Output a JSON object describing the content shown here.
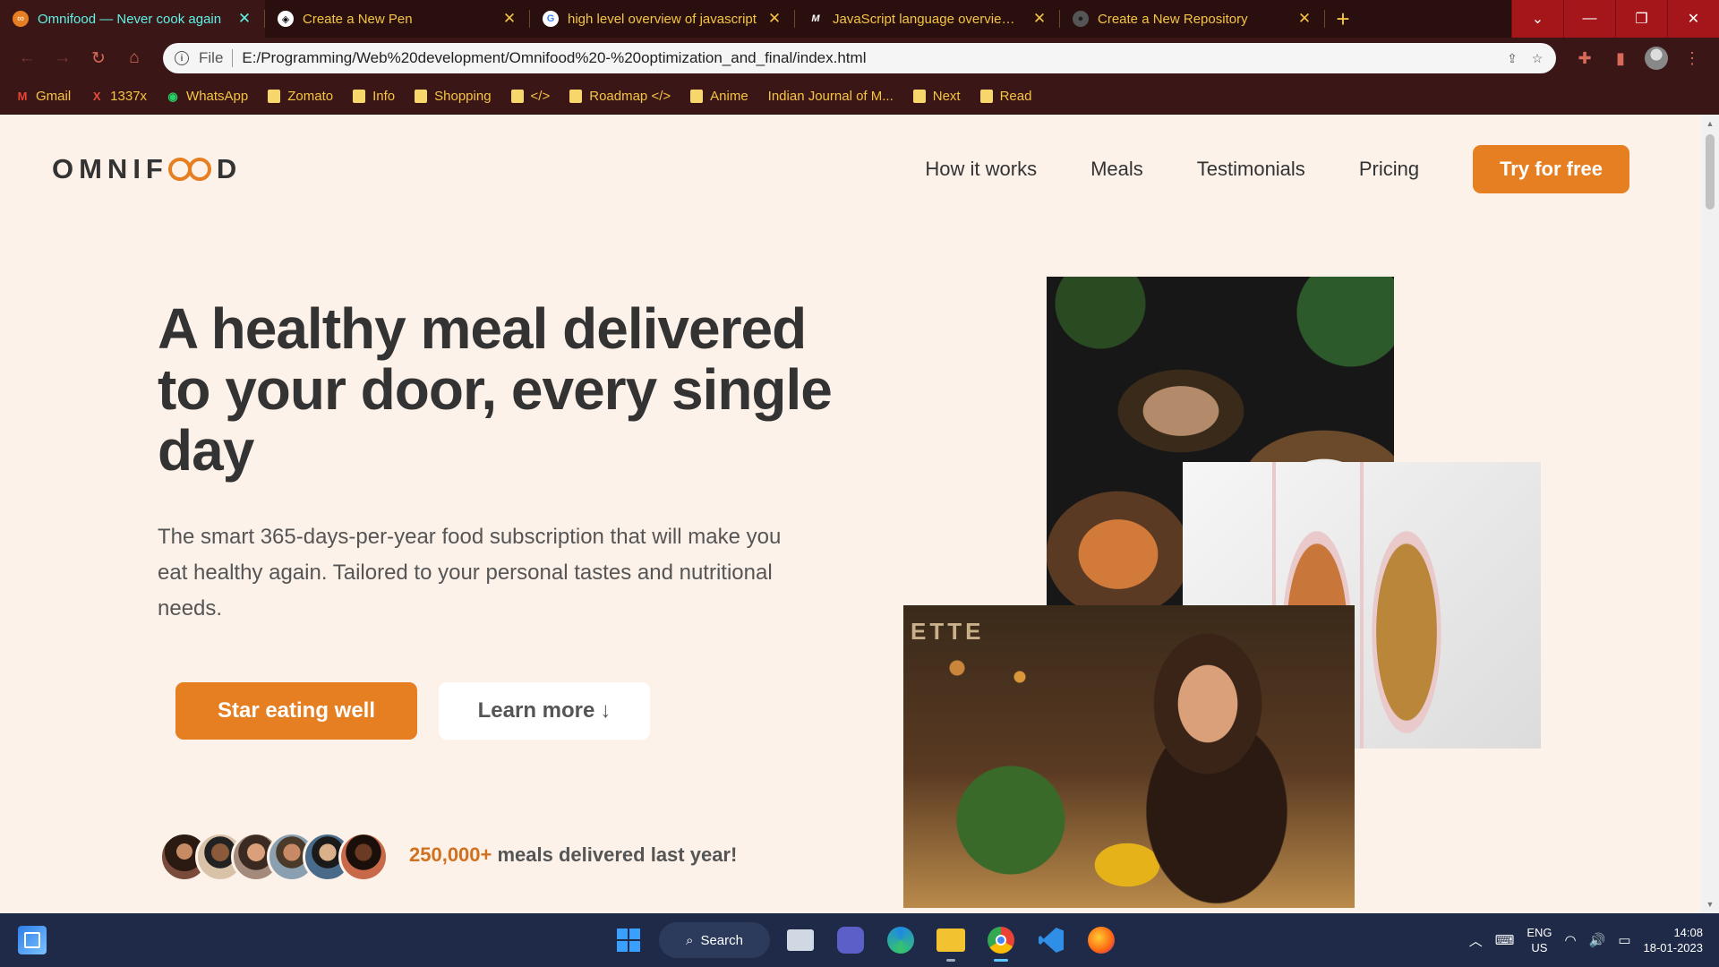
{
  "browser": {
    "tabs": [
      {
        "title": "Omnifood — Never cook again",
        "favicon": "omnifood-icon",
        "active": true
      },
      {
        "title": "Create a New Pen",
        "favicon": "codepen-icon",
        "active": false
      },
      {
        "title": "high level overview of javascript",
        "favicon": "google-icon",
        "active": false
      },
      {
        "title": "JavaScript language overview - Ja",
        "favicon": "mdn-icon",
        "active": false
      },
      {
        "title": "Create a New Repository",
        "favicon": "github-icon",
        "active": false
      }
    ],
    "new_tab": "+",
    "window_controls": {
      "dropdown": "⌄",
      "minimize": "—",
      "restore": "❐",
      "close": "✕"
    },
    "omnibox": {
      "scheme_label": "File",
      "url": "E:/Programming/Web%20development/Omnifood%20-%20optimization_and_final/index.html"
    },
    "bookmarks": [
      {
        "label": "Gmail",
        "icon": "gmail-icon"
      },
      {
        "label": "1337x",
        "icon": "x-icon"
      },
      {
        "label": "WhatsApp",
        "icon": "whatsapp-icon"
      },
      {
        "label": "Zomato",
        "icon": "folder-icon"
      },
      {
        "label": "Info",
        "icon": "folder-icon"
      },
      {
        "label": "Shopping",
        "icon": "folder-icon"
      },
      {
        "label": "</>",
        "icon": "folder-icon"
      },
      {
        "label": "Roadmap </>",
        "icon": "folder-icon"
      },
      {
        "label": "Anime",
        "icon": "folder-icon"
      },
      {
        "label": "Indian Journal of M...",
        "icon": "none"
      },
      {
        "label": "Next",
        "icon": "folder-icon"
      },
      {
        "label": "Read",
        "icon": "folder-icon"
      }
    ]
  },
  "site": {
    "logo_prefix": "OMNIF",
    "logo_suffix": "D",
    "nav": [
      "How it works",
      "Meals",
      "Testimonials",
      "Pricing"
    ],
    "cta_nav": "Try for free",
    "hero": {
      "title": "A healthy meal delivered to your door, every single day",
      "text": "The smart 365-days-per-year food subscription that will make you eat healthy again. Tailored to your personal tastes and nutritional needs.",
      "primary_button": "Star eating well",
      "secondary_button": "Learn more",
      "secondary_arrow": "↓",
      "delivered_number": "250,000+",
      "delivered_text": "meals delivered last year!",
      "cafe_sign": "ETTE"
    },
    "accent_color": "#e67e22"
  },
  "taskbar": {
    "search_label": "Search",
    "language": "ENG",
    "region": "US",
    "time": "14:08",
    "date": "18-01-2023"
  }
}
